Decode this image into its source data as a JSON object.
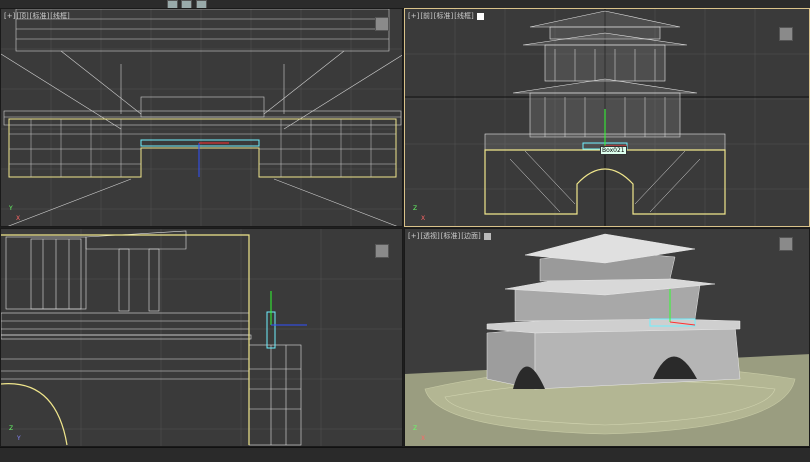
{
  "viewports": {
    "top_left": {
      "label_plus": "[+]",
      "label_view": "[顶]",
      "label_shade": "[标准]",
      "label_mode": "[线框]"
    },
    "top_right": {
      "label_plus": "[+]",
      "label_view": "[前]",
      "label_shade": "[标准]",
      "label_mode": "[线框]"
    },
    "bottom_left": {
      "label_plus": "",
      "label_view": "",
      "label_shade": "",
      "label_mode": ""
    },
    "bottom_right": {
      "label_plus": "[+]",
      "label_view": "[透视]",
      "label_shade": "[标准]",
      "label_mode": "[边面]"
    }
  },
  "selected_object": {
    "name": "Box021"
  },
  "colors": {
    "viewport_bg": "#3a3a3a",
    "wire": "#d6d6d6",
    "selection": "#f0e68c",
    "active_border": "#d9c28a",
    "grid": "#555555"
  },
  "icons": [
    "plus-icon",
    "view-cube-icon",
    "axis-gizmo-icon"
  ]
}
